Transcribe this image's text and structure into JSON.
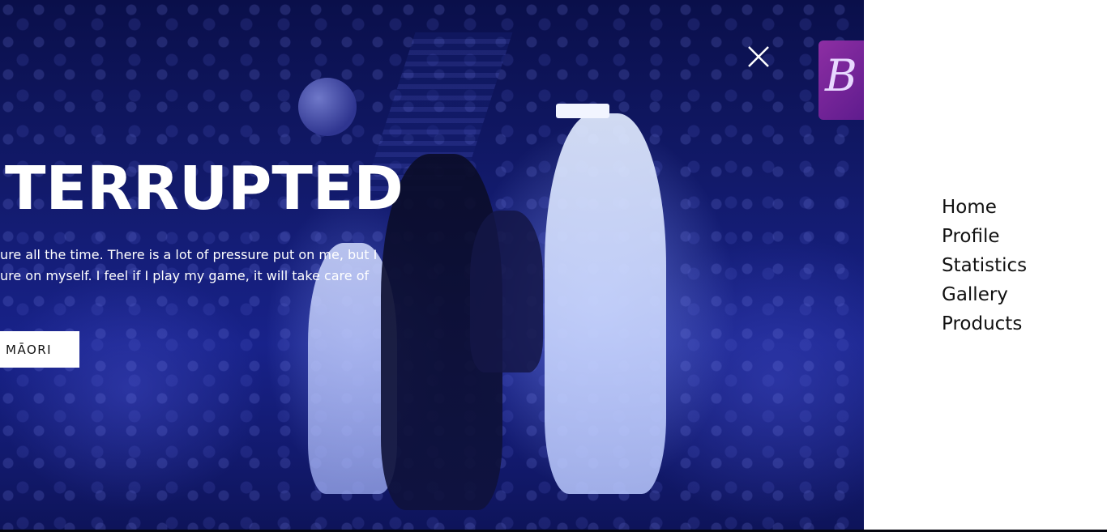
{
  "hero": {
    "title": "TERRUPTED",
    "text_lines": [
      "ure all the time. There is a lot of pressure put on me, but I",
      "ure on myself. I feel if I play my game, it will take care of"
    ],
    "language_button_label": "MĀORI",
    "close_icon": "close-icon",
    "ad_glyph": "B"
  },
  "nav": {
    "items": [
      {
        "label": "Home"
      },
      {
        "label": "Profile"
      },
      {
        "label": "Statistics"
      },
      {
        "label": "Gallery"
      },
      {
        "label": "Products"
      }
    ]
  },
  "colors": {
    "overlay_tint": "#18228a",
    "panel_background": "#ffffff",
    "nav_text": "#111111",
    "hero_text": "#ffffff"
  }
}
